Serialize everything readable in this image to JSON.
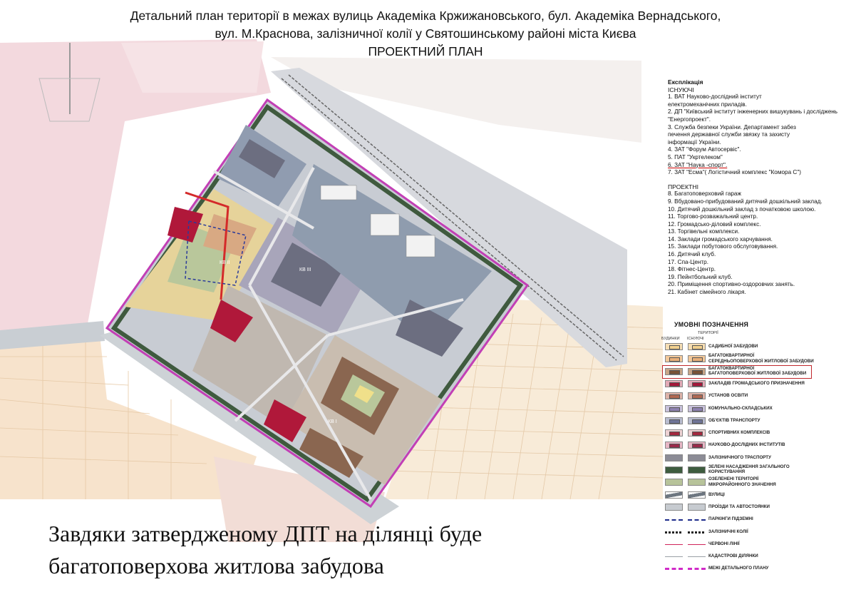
{
  "title": {
    "line1": "Детальний план території в межах вулиць Академіка Кржижановського, бул. Академіка Вернадського,",
    "line2": "вул. М.Краснова, залізничної колії у Святошинському районі  міста Києва",
    "line3": "ПРОЕКТНИЙ ПЛАН"
  },
  "map": {
    "labels": [
      "КВ II",
      "КВ III",
      "КВ I"
    ],
    "colors": {
      "background_pink": "#f3d9de",
      "background_light_pink": "#f7e6e8",
      "background_beige": "#f7e3cc",
      "road": "#c9ced3",
      "green_strip": "#3f5a3e",
      "microdistrict_green": "#b9c79b",
      "lilac": "#b8a9c9",
      "dark_gray": "#6c6e80",
      "maroon": "#b0183a",
      "brown_residential": "#8a6650",
      "yellow": "#f0e08a",
      "boundary_magenta": "#c23fb5",
      "parking_blue": "#2a3a9a"
    }
  },
  "explication": {
    "title": "Експлікація",
    "existing_header": "ІСНУЮЧІ",
    "existing": [
      "1. ВАТ Науково-дослідний інститут",
      "    електромеханічних приладів.",
      "2. ДП \"Київський інститут інженерних вишукувань і досліджень",
      "\"Енергопроект\".",
      "3. Служба безпеки України. Департамент забез",
      "    печення державної служби звязку та захисту",
      "    інформації України.",
      "4. ЗАТ \"Форум Автосервіс\".",
      "5. ПАТ \"Укртелеком\"",
      "6. ЗАТ \"Наука -спорт\".",
      "7. ЗАТ \"Есма\"( Логістичний комплекс \"Комора С\")"
    ],
    "project_header": "ПРОЕКТНІ",
    "project": [
      "8. Багатоповерховий гараж",
      "9. Вбудовано-прибудований дитячий дошкільний заклад.",
      "10. Дитячий дошкільний заклад з початковою школою.",
      "11. Торгово-розважальний центр.",
      "12. Громадсько-діловий комплекс.",
      "13. Торгівельні комплекси.",
      "14. Заклади громадського харчування.",
      "15. Заклади побутового обслуговування.",
      "16. Дитячий клуб.",
      "17. Спа-Центр.",
      "18. Фітнес-Центр.",
      "19. Пейнтбольний клуб.",
      "20. Приміщення спортивно-оздоровчих занять.",
      "21. Кабінет сімейного лікаря."
    ]
  },
  "legend": {
    "title": "УМОВНІ  ПОЗНАЧЕННЯ",
    "col_territory": "ТЕРИТОРІЇ",
    "col_buildings": "БУДИНКИ",
    "col_existing": "ІСНУЮЧІ",
    "items": [
      {
        "label": "САДИБНОЇ ЗАБУДОВИ",
        "fill": "#f6deb4",
        "inner": "#f1d08e",
        "style": "box"
      },
      {
        "label": "БАГАТОКВАРТИРНОЇ\nСЕРЕДНЬОПОВЕРХОВОЇ ЖИТЛОВОЇ ЗАБУДОВИ",
        "fill": "#f3c99b",
        "inner": "#e9b07a",
        "style": "box"
      },
      {
        "label": "БАГАТОКВАРТИРНОЇ\nБАГАТОПОВЕРХОВОЇ ЖИТЛОВОЇ ЗАБУДОВИ",
        "fill": "#c8a588",
        "inner": "#7a5236",
        "style": "box"
      },
      {
        "label": "ЗАКЛАДІВ ГРОМАДСЬКОГО ПРИЗНАЧЕННЯ",
        "fill": "#e3aab7",
        "inner": "#a5173a",
        "style": "box"
      },
      {
        "label": "УСТАНОВ ОСВІТИ",
        "fill": "#ddb3a9",
        "inner": "#b06852",
        "style": "box"
      },
      {
        "label": "КОМУНАЛЬНО-СКЛАДСЬКИХ",
        "fill": "#c9c2dc",
        "inner": "#8e82b0",
        "style": "box"
      },
      {
        "label": "ОБ'ЄКТІВ ТРАНСПОРТУ",
        "fill": "#b9bdd0",
        "inner": "#6f7497",
        "style": "box"
      },
      {
        "label": "СПОРТИВНИХ КОМПЛЕКСІВ",
        "fill": "#eed2d4",
        "inner": "#a3283f",
        "style": "box"
      },
      {
        "label": "НАУКОВО-ДОСЛІДНИХ ІНСТИТУТІВ",
        "fill": "#e8b7c6",
        "inner": "#9a2a4a",
        "style": "box"
      },
      {
        "label": "ЗАЛІЗНИЧНОГО ТРАСПОРТУ",
        "fill": "#8c8c96",
        "inner": "#8c8c96",
        "style": "solid"
      },
      {
        "label": "ЗЕЛЕНІ НАСАДЖЕННЯ ЗАГАЛЬНОГО\nКОРИСТУВАННЯ",
        "fill": "#3e5c3f",
        "inner": "#3e5c3f",
        "style": "solid"
      },
      {
        "label": "ОЗЕЛЕНЕНІ ТЕРИТОРІЇ\nМІКРОРАЙОННОГО ЗНАЧЕННЯ",
        "fill": "#b7c39a",
        "inner": "#b7c39a",
        "style": "solid"
      },
      {
        "label": "ВУЛИЦІ",
        "fill": "#6d7680",
        "inner": "#6d7680",
        "style": "street"
      },
      {
        "label": "ПРОЇЗДИ ТА АВТОСТОЯНКИ",
        "fill": "#c7cbd0",
        "inner": "#c7cbd0",
        "style": "driveway"
      },
      {
        "label": "ПАРКІНГИ ПІДЗЕМНІ",
        "fill": "#1d2b8a",
        "inner": "#1d2b8a",
        "style": "dash"
      },
      {
        "label": "ЗАЛІЗНИЧНІ КОЛІЇ",
        "fill": "#222222",
        "inner": "#222222",
        "style": "rail"
      },
      {
        "label": "ЧЕРВОНІ ЛІНІЇ",
        "fill": "#d0245a",
        "inner": "#d0245a",
        "style": "redline"
      },
      {
        "label": "КАДАСТРОВІ ДІЛЯНКИ",
        "fill": "#9aa0a6",
        "inner": "#9aa0a6",
        "style": "cadastre"
      },
      {
        "label": "МЕЖІ ДЕТАЛЬНОГО ПЛАНУ",
        "fill": "#d12bc8",
        "inner": "#d12bc8",
        "style": "magentadash"
      }
    ]
  },
  "caption": {
    "line1": "Завдяки затвердженому ДПТ на ділянці буде",
    "line2": "багатоповерхова житлова забудова"
  }
}
